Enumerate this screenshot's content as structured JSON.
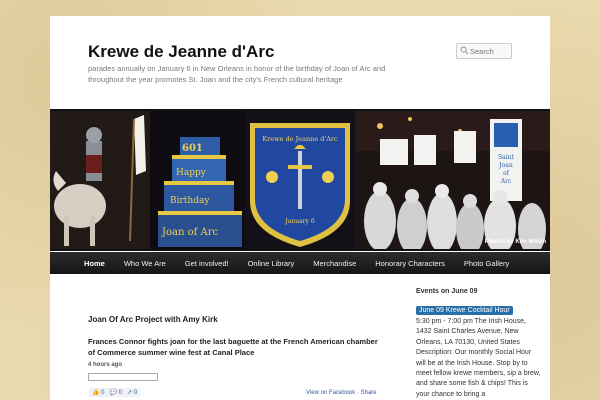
{
  "site": {
    "title": "Krewe de Jeanne d'Arc",
    "description": "parades annually on January 6 in New Orleans in honor of the birthday of Joan of Arc and throughout the year promotes St. Joan and the city's French cultural heritage"
  },
  "search": {
    "placeholder": "Search"
  },
  "banner": {
    "credit": "Photos by Kim Welsh"
  },
  "nav": {
    "items": [
      "Home",
      "Who We Are",
      "Get involved!",
      "Online Library",
      "Merchandise",
      "Honorary Characters",
      "Photo Gallery"
    ]
  },
  "main": {
    "post_title": "Joan Of Arc Project with Amy Kirk",
    "post_heading": "Frances Connor fights joan for the last baguette at the French American chamber of Commerce summer wine fest at Canal Place",
    "time": "4 hours ago",
    "view_on_facebook": "View on Facebook",
    "share": "Share",
    "dot": "·",
    "reactions": {
      "likes": "0",
      "comments": "0",
      "shares": "0"
    }
  },
  "sidebar": {
    "heading": "Events on June 09",
    "event_title": "June 09 Krewe Cocktail Hour",
    "event_body": "5:30 pm - 7:00 pm The Irish House, 1432 Saint Charles Avenue, New Orleans, LA 70130, United States Description: Our monthly Social Hour will be at the Irish House. Stop by to meet fellow krewe members, sip a brew, and share some fish & chips! This is your chance to bring a"
  },
  "colors": {
    "background": "#e9d9ae",
    "nav": "#1f1f1f",
    "link": "#3b5998",
    "event_badge": "#2a6ea6"
  }
}
